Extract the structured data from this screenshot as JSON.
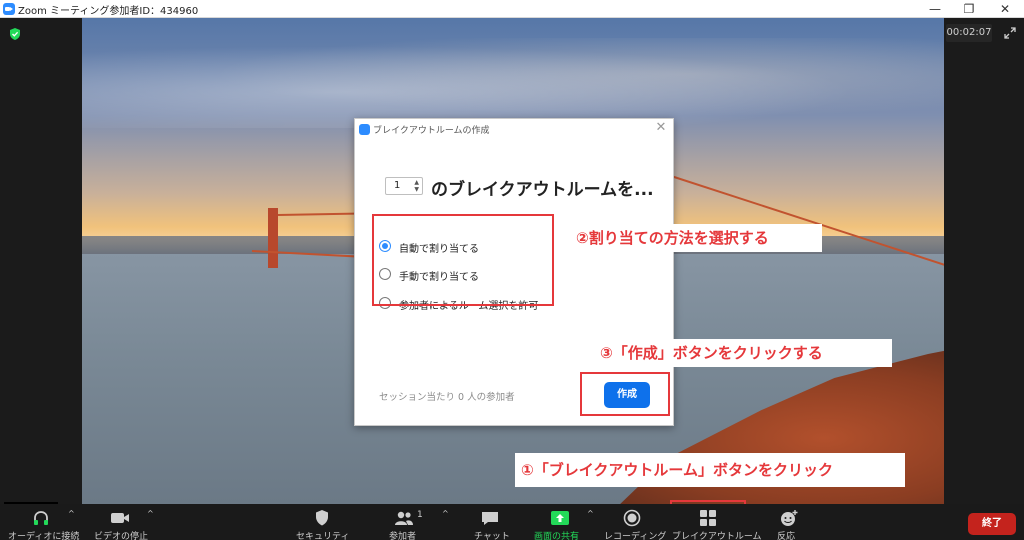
{
  "window": {
    "title": "Zoom ミーティング参加者ID：434960",
    "minimize": "—",
    "restore": "❐",
    "close": "✕"
  },
  "meeting": {
    "timer": "00:02:07",
    "security_badge": "shield-check-icon"
  },
  "dialog": {
    "title": "ブレイクアウトルームの作成",
    "close": "✕",
    "room_count": "1",
    "heading": "のブレイクアウトルームを...",
    "options": [
      {
        "label": "自動で割り当てる",
        "checked": true
      },
      {
        "label": "手動で割り当てる",
        "checked": false
      },
      {
        "label": "参加者によるルーム選択を許可",
        "checked": false
      }
    ],
    "participants_note": "セッション当たり 0 人の参加者",
    "create_button": "作成"
  },
  "annotations": {
    "step1": "①「ブレイクアウトルーム」ボタンをクリック",
    "step2": "②割り当ての方法を選択する",
    "step3": "③「作成」ボタンをクリックする",
    "accent_color": "#e5383b"
  },
  "toolbar": {
    "audio": "オーディオに接続",
    "video": "ビデオの停止",
    "security": "セキュリティ",
    "participants": "参加者",
    "participants_count": "1",
    "chat": "チャット",
    "share": "画面の共有",
    "record": "レコーディング",
    "breakout": "ブレイクアウトルーム",
    "reactions": "反応",
    "end": "終了"
  },
  "colors": {
    "zoom_blue": "#2d8cff",
    "create_blue": "#0e71eb",
    "end_red": "#c4231d",
    "share_green": "#23d959"
  }
}
